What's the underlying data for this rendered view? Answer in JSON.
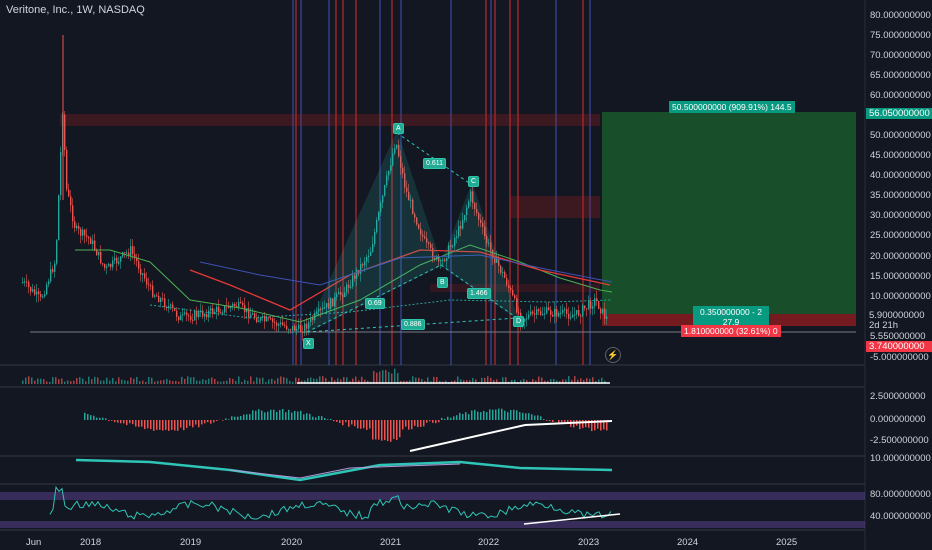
{
  "header": {
    "title": "Veritone, Inc., 1W, NASDAQ"
  },
  "price_axis": {
    "main_labels": [
      "80.000000000",
      "75.000000000",
      "70.000000000",
      "65.000000000",
      "60.000000000",
      "55.000000000",
      "50.000000000",
      "45.000000000",
      "40.000000000",
      "35.000000000",
      "30.000000000",
      "25.000000000",
      "20.000000000",
      "15.000000000",
      "10.000000000",
      "5.550000000"
    ],
    "target_price": "56.050000000",
    "current_price": "5.900000000",
    "countdown": "2d 21h",
    "stop_price": "3.740000000",
    "bottom_label": "-5.000000000",
    "macd_labels": [
      "2.500000000",
      "0.000000000",
      "-2.500000000"
    ],
    "stoch_labels": [
      "10.000000000"
    ],
    "rsi_labels": [
      "80.000000000",
      "40.000000000"
    ]
  },
  "time_axis": {
    "labels": [
      "Jun",
      "2018",
      "2019",
      "2020",
      "2021",
      "2022",
      "2023",
      "2024",
      "2025"
    ]
  },
  "pattern": {
    "points": [
      "X",
      "A",
      "B",
      "C",
      "D"
    ],
    "ratios": [
      "0.611",
      "0.69",
      "1.466",
      "0.886"
    ]
  },
  "position": {
    "target_label": "50.500000000 (909.91%) 144.5",
    "entry_label_1": "0.350000000 - 2",
    "entry_label_2": "27.9",
    "stop_label": "1.810000000 (32.61%) 0"
  },
  "colors": {
    "bg": "#131722",
    "up": "#26a69a",
    "down": "#ef5350",
    "pattern": "#2ec4b6",
    "profit": "#1e7d32",
    "loss": "#b71c1c"
  },
  "icons": {
    "flash": "lightning-icon"
  }
}
